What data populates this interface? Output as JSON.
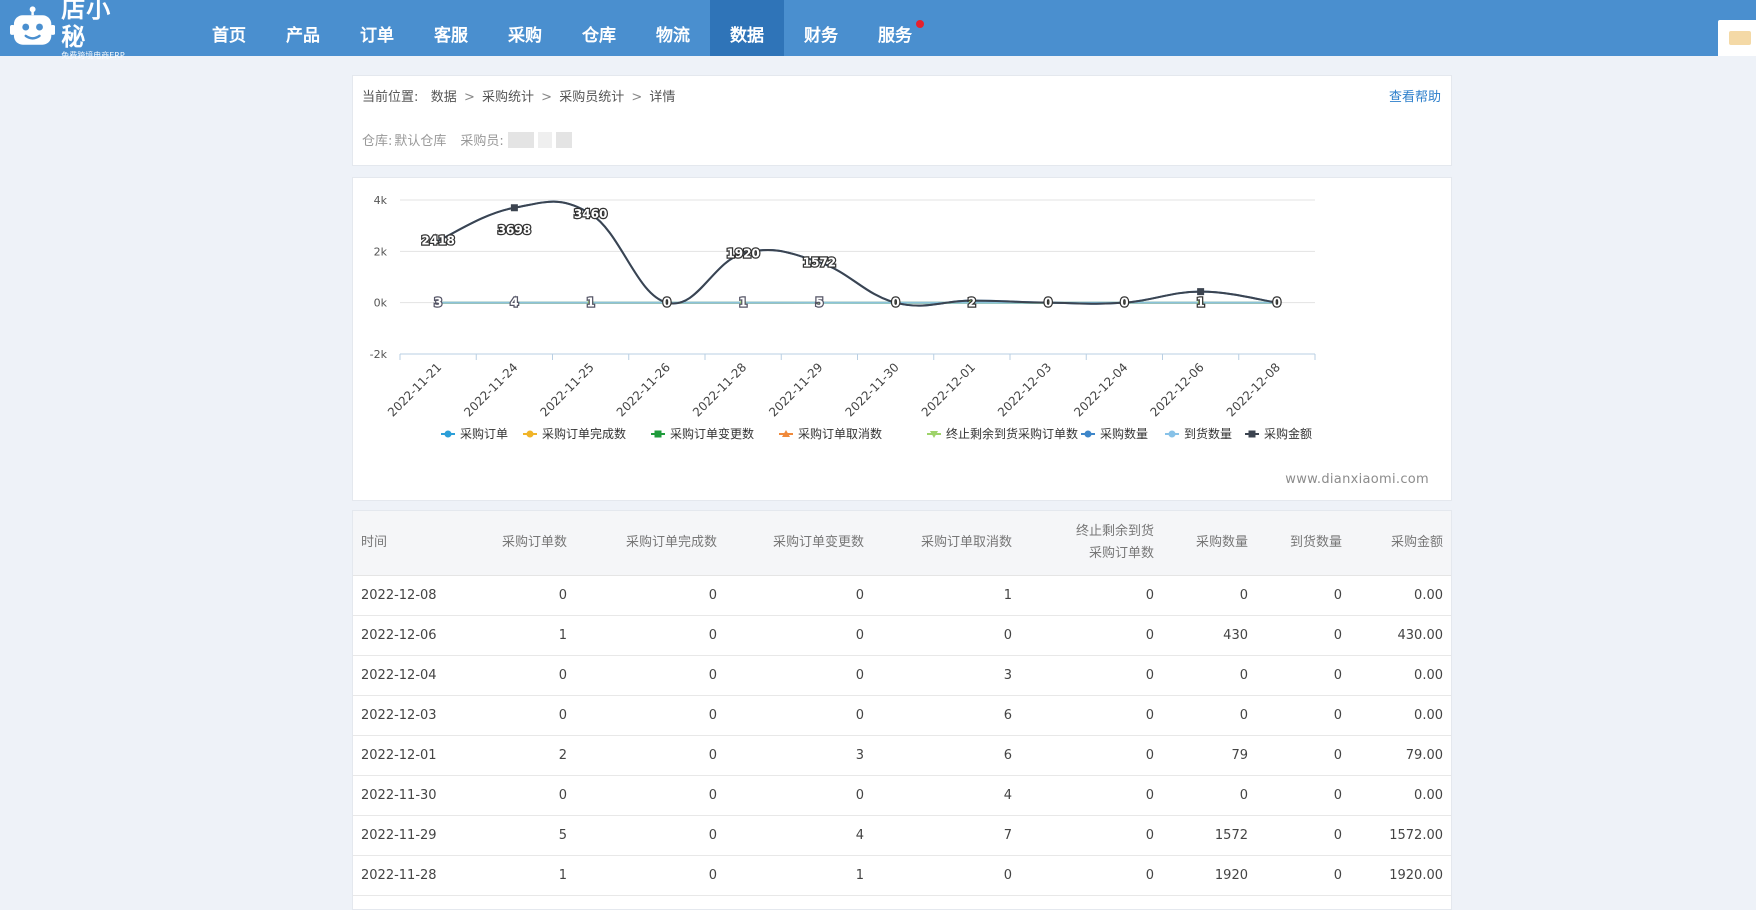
{
  "brand": {
    "name": "店小秘",
    "slogan": "免费跨境电商ERP"
  },
  "nav": {
    "items": [
      {
        "label": "首页"
      },
      {
        "label": "产品"
      },
      {
        "label": "订单"
      },
      {
        "label": "客服"
      },
      {
        "label": "采购"
      },
      {
        "label": "仓库"
      },
      {
        "label": "物流"
      },
      {
        "label": "数据",
        "active": true
      },
      {
        "label": "财务"
      },
      {
        "label": "服务",
        "badge": true
      }
    ]
  },
  "breadcrumb": {
    "prefix": "当前位置:",
    "items": [
      "数据",
      "采购统计",
      "采购员统计",
      "详情"
    ],
    "separator": ">",
    "help": "查看帮助"
  },
  "filters": {
    "warehouse_label": "仓库:",
    "warehouse_value": "默认仓库",
    "buyer_label": "采购员:"
  },
  "watermark": "www.dianxiaomi.com",
  "colors": {
    "nav_bg": "#4a8fcf",
    "nav_active": "#2f74b8",
    "link": "#2d7fcb",
    "amount_line": "#2e3a4f",
    "flat_line": "#7ec3d9"
  },
  "chart_data": {
    "type": "line",
    "categories": [
      "2022-11-21",
      "2022-11-24",
      "2022-11-25",
      "2022-11-26",
      "2022-11-28",
      "2022-11-29",
      "2022-11-30",
      "2022-12-01",
      "2022-12-03",
      "2022-12-04",
      "2022-12-06",
      "2022-12-08"
    ],
    "y_ticks": [
      "4k",
      "2k",
      "0k",
      "-2k"
    ],
    "ylim": [
      -2000,
      4000
    ],
    "grid": true,
    "legend_position": "bottom",
    "series": [
      {
        "name": "采购订单",
        "values": [
          3,
          4,
          1,
          0,
          1,
          5,
          0,
          2,
          0,
          0,
          1,
          0
        ],
        "color": "#2c9fd8",
        "marker": "circle"
      },
      {
        "name": "采购订单完成数",
        "values": [
          0,
          0,
          0,
          0,
          0,
          0,
          0,
          0,
          0,
          0,
          0,
          0
        ],
        "color": "#f0b429",
        "marker": "circle"
      },
      {
        "name": "采购订单变更数",
        "values": [
          0,
          0,
          0,
          0,
          1,
          4,
          0,
          3,
          0,
          0,
          0,
          0
        ],
        "color": "#1e9b3b",
        "marker": "square"
      },
      {
        "name": "采购订单取消数",
        "values": [
          0,
          0,
          0,
          0,
          0,
          7,
          4,
          6,
          6,
          3,
          0,
          1
        ],
        "color": "#f08a3c",
        "marker": "triangle"
      },
      {
        "name": "终止剩余到货采购订单数",
        "values": [
          0,
          0,
          0,
          0,
          0,
          0,
          0,
          0,
          0,
          0,
          0,
          0
        ],
        "color": "#9ed36a",
        "marker": "triangle-down"
      },
      {
        "name": "采购数量",
        "values": [
          2418,
          3698,
          3460,
          0,
          1920,
          1572,
          0,
          79,
          0,
          0,
          430,
          0
        ],
        "color": "#3e86c9",
        "marker": "circle"
      },
      {
        "name": "到货数量",
        "values": [
          0,
          0,
          0,
          0,
          0,
          0,
          0,
          0,
          0,
          0,
          0,
          0
        ],
        "color": "#88c2e8",
        "marker": "circle"
      },
      {
        "name": "采购金额",
        "values": [
          2418,
          3698,
          3460,
          0,
          1920,
          1572,
          0,
          79,
          0,
          0,
          430,
          0
        ],
        "color": "#3c4450",
        "marker": "square"
      }
    ],
    "data_labels_top": [
      "2418",
      "3698",
      "3460",
      "0",
      "1920",
      "1572",
      "0",
      "2",
      "0",
      "0",
      "1",
      "0"
    ],
    "data_labels_bottom": [
      "3",
      "4",
      "1",
      "",
      "1",
      "5",
      "",
      "",
      "",
      "",
      "",
      ""
    ]
  },
  "table": {
    "headers": [
      "时间",
      "采购订单数",
      "采购订单完成数",
      "采购订单变更数",
      "采购订单取消数",
      "终止剩余到货采购订单数",
      "采购数量",
      "到货数量",
      "采购金额"
    ],
    "header_col6_line1": "终止剩余到货",
    "header_col6_line2": "采购订单数",
    "rows": [
      [
        "2022-12-08",
        "0",
        "0",
        "0",
        "1",
        "0",
        "0",
        "0",
        "0.00"
      ],
      [
        "2022-12-06",
        "1",
        "0",
        "0",
        "0",
        "0",
        "430",
        "0",
        "430.00"
      ],
      [
        "2022-12-04",
        "0",
        "0",
        "0",
        "3",
        "0",
        "0",
        "0",
        "0.00"
      ],
      [
        "2022-12-03",
        "0",
        "0",
        "0",
        "6",
        "0",
        "0",
        "0",
        "0.00"
      ],
      [
        "2022-12-01",
        "2",
        "0",
        "3",
        "6",
        "0",
        "79",
        "0",
        "79.00"
      ],
      [
        "2022-11-30",
        "0",
        "0",
        "0",
        "4",
        "0",
        "0",
        "0",
        "0.00"
      ],
      [
        "2022-11-29",
        "5",
        "0",
        "4",
        "7",
        "0",
        "1572",
        "0",
        "1572.00"
      ],
      [
        "2022-11-28",
        "1",
        "0",
        "1",
        "0",
        "0",
        "1920",
        "0",
        "1920.00"
      ]
    ]
  }
}
